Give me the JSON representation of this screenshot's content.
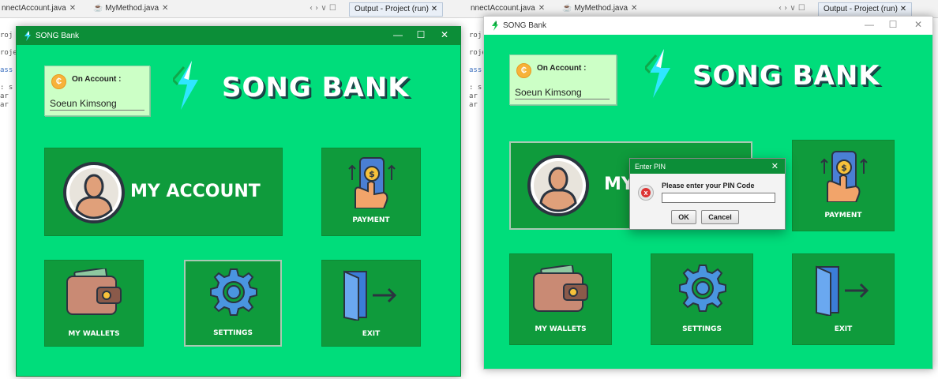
{
  "ide": {
    "tabs": [
      "nnectAccount.java",
      "MyMethod.java"
    ],
    "output_tab": "Output - Project (run)",
    "gutter": [
      "roj",
      "",
      "roje",
      "",
      "ass",
      "",
      ": s",
      "ar",
      "ar"
    ]
  },
  "ide_right": {
    "tabs": [
      "nnectAccount.java",
      "MyMethod.java"
    ],
    "output_tab": "Output - Project (run)",
    "gutter": [
      "roj",
      "",
      "roje",
      "",
      "ass",
      "",
      ": s",
      "ar",
      "ar"
    ]
  },
  "app": {
    "window_title": "SONG Bank",
    "brand": "SONG BANK",
    "account_label": "On Account :",
    "account_name": "Soeun Kimsong",
    "tiles": {
      "my_account": "MY ACCOUNT",
      "payment": "PAYMENT",
      "wallets": "MY WALLETS",
      "settings": "SETTINGS",
      "exit": "EXIT"
    },
    "colors": {
      "background": "#00dd7b",
      "tile": "#0f9b3c",
      "titlebar": "#0c8e38",
      "account_card": "#ccffc6"
    }
  },
  "app_right": {
    "window_title": "SONG Bank",
    "brand": "SONG BANK",
    "account_label": "On Account :",
    "account_name": "Soeun Kimsong",
    "tiles": {
      "my_account_partial": "MY",
      "payment": "PAYMENT",
      "wallets": "MY WALLETS",
      "settings": "SETTINGS",
      "exit": "EXIT"
    }
  },
  "dialog": {
    "title": "Enter PIN",
    "message": "Please enter your PIN Code",
    "pin_value": "",
    "ok_label": "OK",
    "cancel_label": "Cancel",
    "icon": "error-icon"
  },
  "window_controls": {
    "minimize": "—",
    "maximize": "☐",
    "close": "✕"
  }
}
